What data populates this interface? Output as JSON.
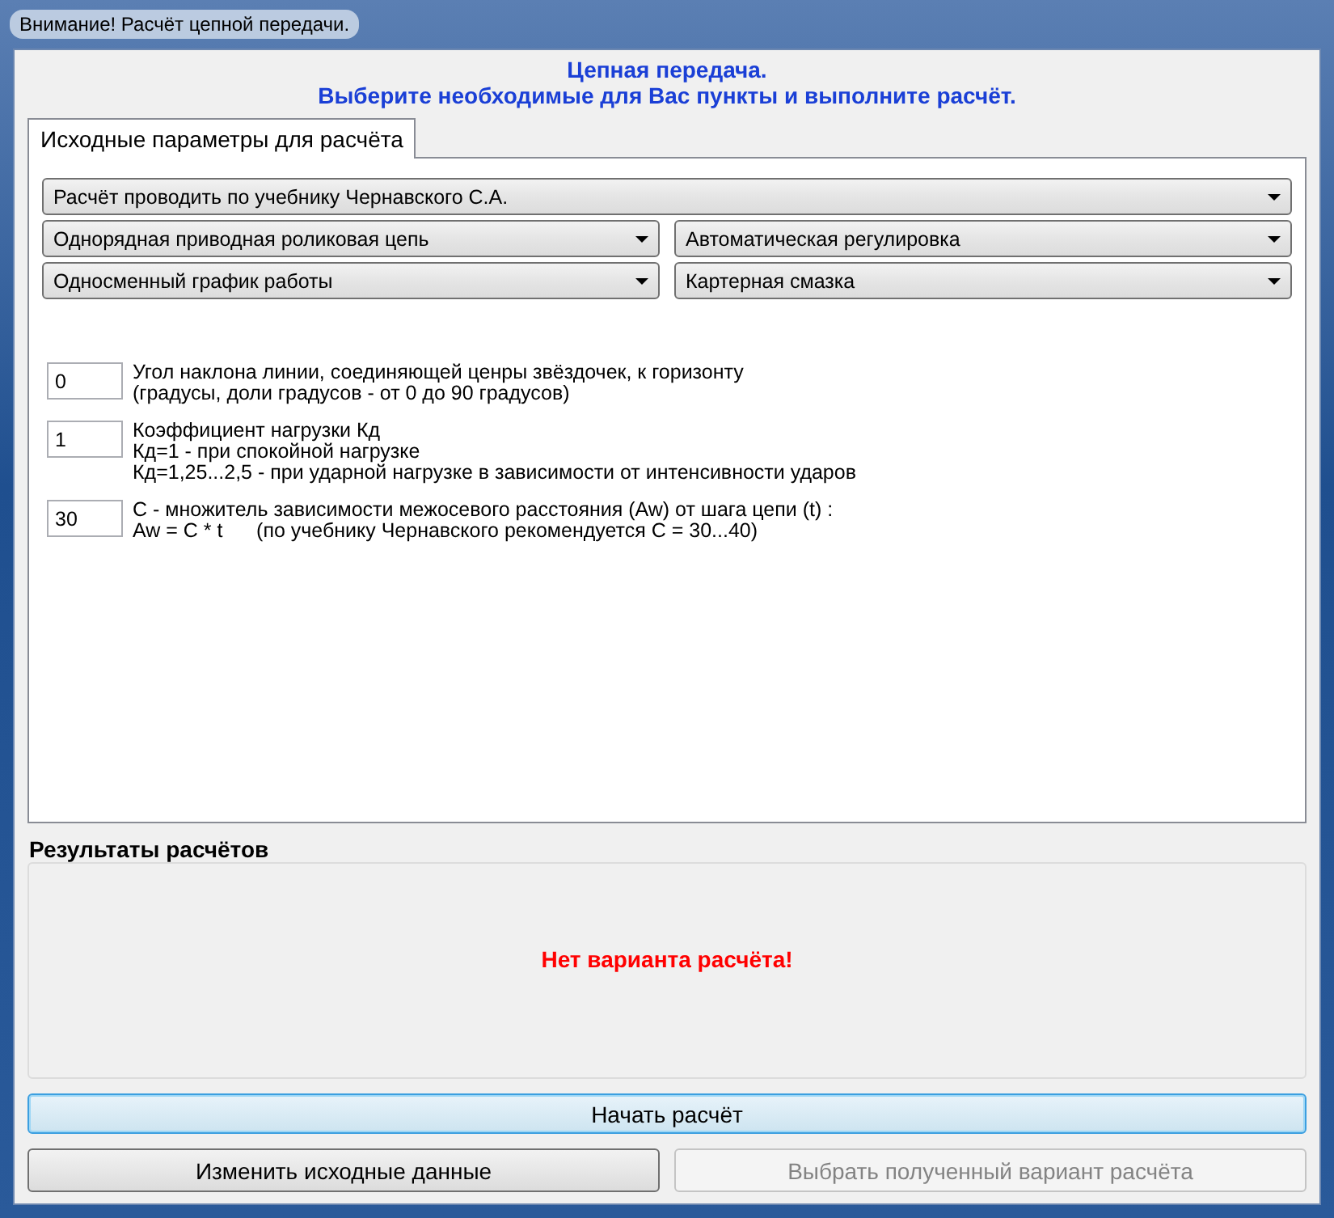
{
  "window": {
    "title": "Внимание! Расчёт цепной передачи."
  },
  "header": [
    "Цепная передача.",
    "Выберите необходимые для Вас пункты и выполните расчёт."
  ],
  "tabs": [
    {
      "label": "Исходные параметры для расчёта",
      "selected": true
    }
  ],
  "dropdown_rows": [
    [
      {
        "value": "Расчёт проводить по учебнику Чернавского С.А."
      }
    ],
    [
      {
        "value": "Однорядная приводная роликовая цепь"
      },
      {
        "value": "Автоматическая регулировка"
      }
    ],
    [
      {
        "value": "Односменный график работы"
      },
      {
        "value": "Картерная смазка"
      }
    ]
  ],
  "parameters": [
    {
      "value": "0",
      "lines": [
        "Угол наклона линии, соединяющей ценры звёздочек, к горизонту",
        "(градусы, доли градусов - от 0 до 90 градусов)"
      ]
    },
    {
      "value": "1",
      "lines": [
        "Коэффициент нагрузки Кд",
        "Кд=1 - при спокойной нагрузке",
        "Кд=1,25...2,5 - при ударной нагрузке в зависимости от интенсивности ударов"
      ]
    },
    {
      "value": "30",
      "lines": [
        "С - множитель зависимости межосевого расстояния (Aw) от шага цепи (t) :",
        "Aw = C * t      (по учебнику Чернавского рекомендуется С = 30...40)"
      ]
    }
  ],
  "results": {
    "title": "Результаты расчётов",
    "message": "Нет варианта расчёта!"
  },
  "start_button": {
    "label": "Начать расчёт",
    "focused": true
  },
  "buttons": [
    {
      "label": "Изменить исходные данные",
      "disabled": false
    },
    {
      "label": "Выбрать полученный вариант расчёта",
      "disabled": true
    }
  ]
}
